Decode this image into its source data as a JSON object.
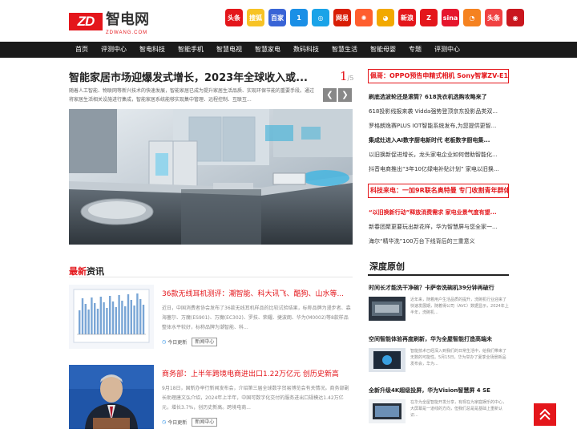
{
  "brand": {
    "logo_mark": "ZD",
    "name": "智电网",
    "domain": "ZDWANG.COM",
    "accent": "#e4161b"
  },
  "partners": [
    {
      "name": "头条",
      "color": "#e4161b"
    },
    {
      "name": "搜狐",
      "color": "#f7c325"
    },
    {
      "name": "百家",
      "color": "#3964d6"
    },
    {
      "name": "1",
      "color": "#1a8fe6"
    },
    {
      "name": "◎",
      "color": "#1aa3e8"
    },
    {
      "name": "网易",
      "color": "#d81e06"
    },
    {
      "name": "✺",
      "color": "#ff5e2e"
    },
    {
      "name": "◕",
      "color": "#f2a900"
    },
    {
      "name": "新浪",
      "color": "#e4161b"
    },
    {
      "name": "Z",
      "color": "#e4161b"
    },
    {
      "name": "sina",
      "color": "#e6162d"
    },
    {
      "name": "◔",
      "color": "#f58220"
    },
    {
      "name": "头条",
      "color": "#f04142"
    },
    {
      "name": "◉",
      "color": "#c9171e"
    }
  ],
  "nav": [
    "首页",
    "评测中心",
    "智电科技",
    "智能手机",
    "智慧电视",
    "智慧家电",
    "数码科技",
    "智慧生活",
    "智能母婴",
    "专题",
    "评测中心"
  ],
  "headline": {
    "title": "智能家居市场迎爆发式增长，2023年全球收入或...",
    "page_current": "1",
    "page_total": "/5",
    "lead": "随着人工智能、物联网等新兴技术的快速发展，智能家居已成为提升家居生活品质、实现环保节能的重要手段。通过将家居生活相关设施进行集成，智能家居系统能够实现集中管理、远程控制、互联互..."
  },
  "latest": {
    "highlight": "最新",
    "rest": "资讯"
  },
  "news": [
    {
      "title": "36款无线耳机测评：潮智能、科大讯飞、酷狗、山水等...",
      "desc": "近日，中国消费者协会发布了36款无线耳机样品的比较试验结果，标称品牌为漫步者、森海塞尔、万魔(ES901)、万魔(EC302)、罗技、荣耀、捷波朗、华为(M0002)等8款样品整体水平较好，标称品牌为潮智能、科...",
      "time": "今日更新",
      "tag": "新闻中心"
    },
    {
      "title": "商务部：上半年跨境电商进出口1.22万亿元 创历史新高",
      "desc": "9月18日，国新办举行新闻发布会，介绍第三届全球数字贸易博览会有关情况。商务部副长助理唐文弘介绍，2024年上半年，中国可数字化交付的服务进出口规模达1.42万亿元，增长3.7%，创历史新高。跨境电商...",
      "time": "今日更新",
      "tag": "新闻中心"
    }
  ],
  "sidebar": {
    "box1_title": "佩哥：OPPO预告申精式相机 Sony智掌ZV-E1...",
    "box1_lines": [
      {
        "text": "刷底选波轮还是滚筒？618洗衣机选购攻略来了",
        "style": "bold"
      },
      {
        "text": "618投影线报来袭 Vidda强势登顶京东投影品类双...",
        "style": "normal"
      },
      {
        "text": "罗格朗逸赛PLUS IOT智能系统发布,为您提供更智...",
        "style": "normal"
      },
      {
        "text": "集成灶进入AI数字厨电新时代 老板数字厨电集...",
        "style": "bold"
      },
      {
        "text": "以旧换新促进增长，龙头家电企业如何借助智能化...",
        "style": "normal"
      },
      {
        "text": "抖音电商推出“3年10亿绿电补贴计划” 家电以旧换...",
        "style": "normal"
      }
    ],
    "box2_title": "科技来电：一加9R联名奥特曼 专门收割青年群体",
    "box2_lines": [
      {
        "text": "“以旧换新行动”释放消费需求 家电业景气度有望...",
        "style": "red"
      },
      {
        "text": "新春团聚更要玩出新花样，华为智慧屏与您全家一...",
        "style": "normal"
      },
      {
        "text": "海尔“精华洗”100万台下线背后的三重意义",
        "style": "normal"
      }
    ]
  },
  "deep": {
    "title": "深度原创",
    "items": [
      {
        "title": "时间长才能洗干净碗？卡萨帝洗碗机39分钟再破行",
        "desc": "近年来，随着用户生活品质的提升，洗碗机行业迎来了快速发展期，随着得公司（AVC）数据显示，2024年上半年，洗碗机..."
      },
      {
        "title": "空间智能体验再度刷新，华为全屋智能打造高端未",
        "desc": "智能技术已经深入到我们的日常生活中，给我们带来了无数的可能性。5月15日，华为举办了夏季全场景新品发布会，华为..."
      },
      {
        "title": "全新升级4K超级投屏，华为Vision智慧屏 4 SE",
        "desc": "在华为全屋智能开发分享，有现在为家庭娱乐的中心，大屏幕是一道线的方向，但我们总是是基础上重新认识..."
      }
    ]
  }
}
